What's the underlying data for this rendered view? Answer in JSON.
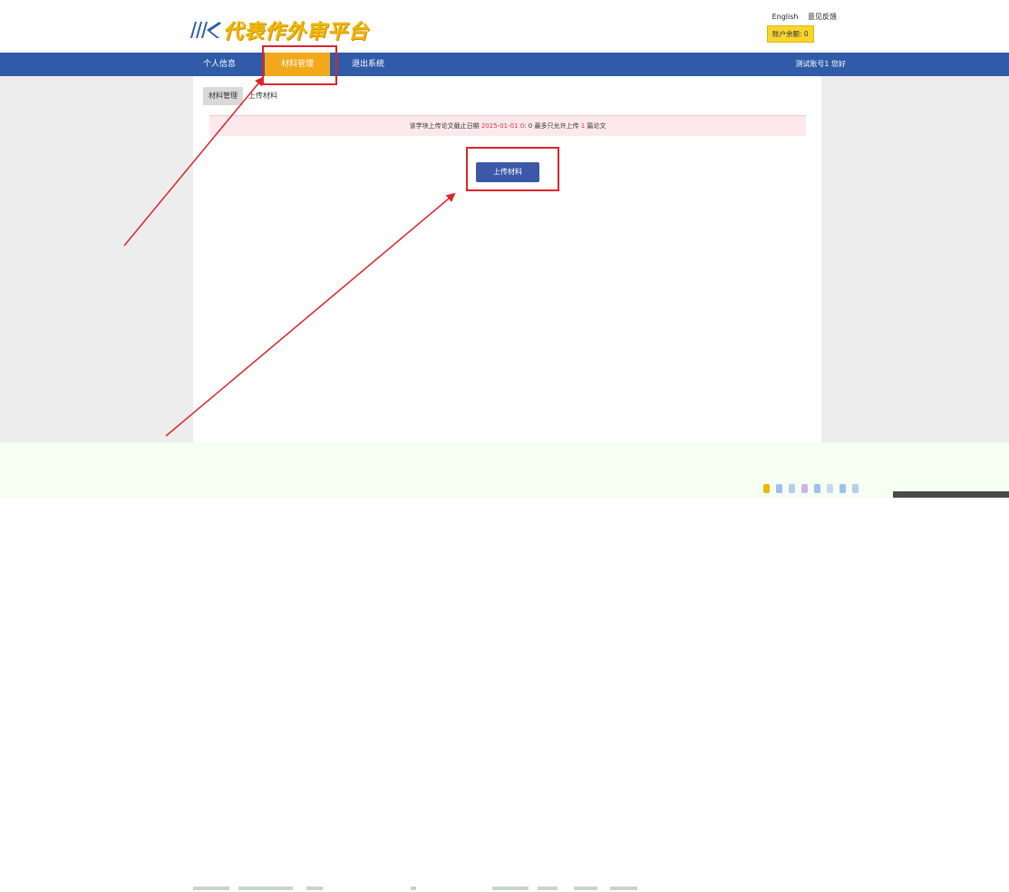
{
  "header": {
    "logo_text": "代表作外审平台",
    "links": {
      "english": "English",
      "feedback": "意见反馈"
    },
    "balance": "账户余额: 0"
  },
  "nav": {
    "items": [
      {
        "label": "个人信息"
      },
      {
        "label": "材料管理"
      },
      {
        "label": "退出系统"
      }
    ],
    "active_index": 1,
    "user_text": "测试账号1 您好"
  },
  "tabs": [
    {
      "label": "材料管理"
    },
    {
      "label": "上传材料"
    }
  ],
  "notice": {
    "prefix": "该学块上传论文截止日期",
    "deadline": "2025-01-01 0",
    "mid": ": 0 最多只允许上传",
    "count": "1",
    "suffix": "篇论文"
  },
  "upload_button": "上传材料",
  "colors": {
    "nav_bg": "#2f5ba8",
    "nav_active": "#f3a81a",
    "button": "#3b59a8",
    "annotation": "#e0232a",
    "logo": "#f2b705"
  }
}
